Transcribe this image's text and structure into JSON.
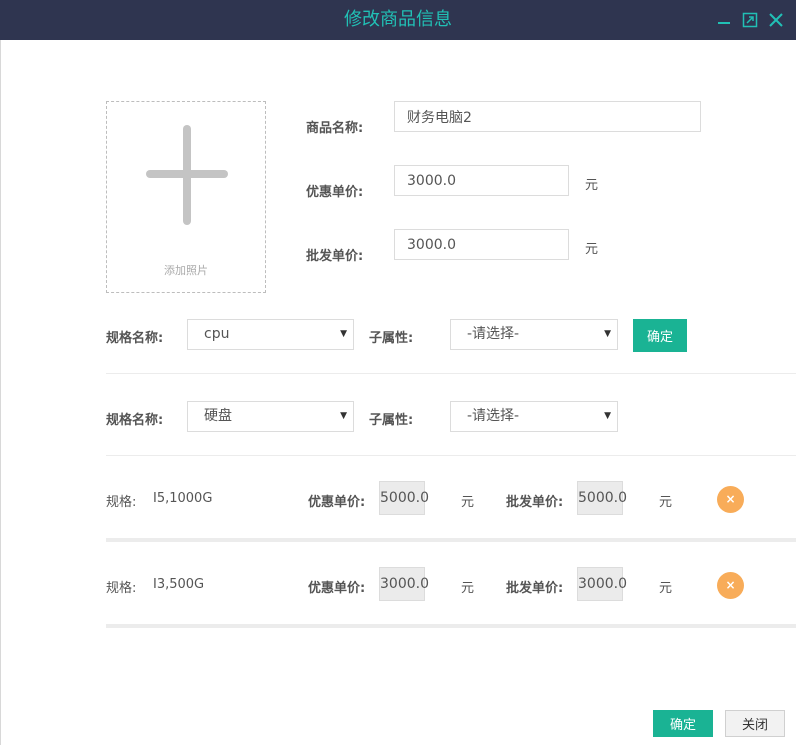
{
  "window": {
    "title": "修改商品信息",
    "minimize_icon": "minimize-icon",
    "maximize_icon": "maximize-icon",
    "close_icon": "close-icon"
  },
  "photo": {
    "label": "添加照片",
    "icon": "plus-icon"
  },
  "form": {
    "name_label": "商品名称:",
    "name_value": "财务电脑2",
    "discount_label": "优惠单价:",
    "discount_value": "3000.0",
    "discount_unit": "元",
    "wholesale_label": "批发单价:",
    "wholesale_value": "3000.0",
    "wholesale_unit": "元"
  },
  "specs": [
    {
      "name_label": "规格名称:",
      "name_value": "cpu",
      "sub_label": "子属性:",
      "sub_value": "-请选择-",
      "confirm_label": "确定"
    },
    {
      "name_label": "规格名称:",
      "name_value": "硬盘",
      "sub_label": "子属性:",
      "sub_value": "-请选择-"
    }
  ],
  "spec_rows": [
    {
      "spec_label": "规格:",
      "spec_value": "I5,1000G",
      "discount_label": "优惠单价:",
      "discount_value": "5000.0",
      "discount_unit": "元",
      "wholesale_label": "批发单价:",
      "wholesale_value": "5000.0",
      "wholesale_unit": "元",
      "delete_icon": "×"
    },
    {
      "spec_label": "规格:",
      "spec_value": "I3,500G",
      "discount_label": "优惠单价:",
      "discount_value": "3000.0",
      "discount_unit": "元",
      "wholesale_label": "批发单价:",
      "wholesale_value": "3000.0",
      "wholesale_unit": "元",
      "delete_icon": "×"
    }
  ],
  "footer": {
    "confirm_label": "确定",
    "close_label": "关闭"
  },
  "colors": {
    "titlebar": "#2f3550",
    "accent": "#21c0b5",
    "primary_button": "#1ab394",
    "delete_button": "#f8ac59"
  }
}
